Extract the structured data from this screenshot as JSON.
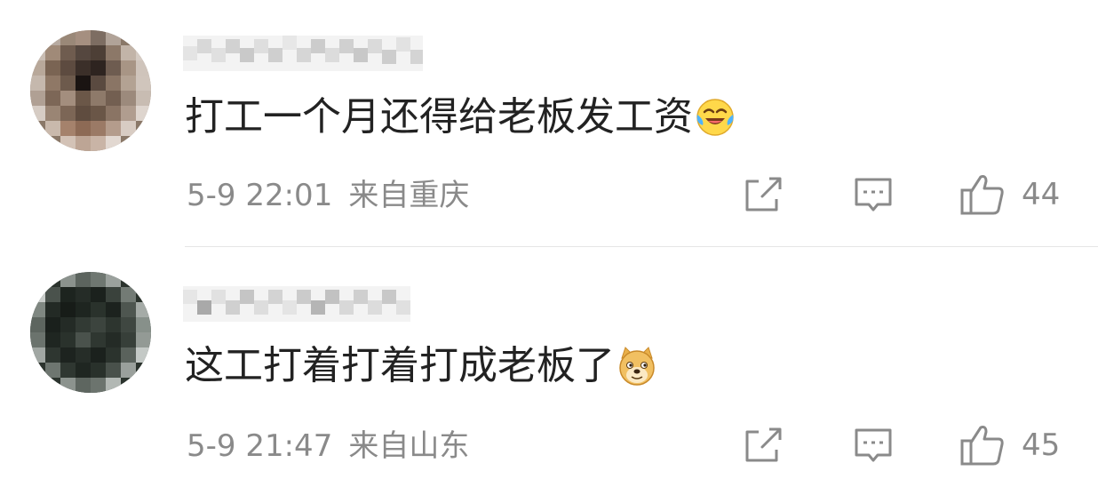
{
  "comments": [
    {
      "text": "打工一个月还得给老板发工资",
      "emoji": "laugh-cry-emoji",
      "time": "5-9 22:01",
      "location": "来自重庆",
      "likes": "44"
    },
    {
      "text": "这工打着打着打成老板了",
      "emoji": "doge-emoji",
      "time": "5-9 21:47",
      "location": "来自山东",
      "likes": "45"
    }
  ],
  "colors": {
    "text": "#222222",
    "meta": "#8a8a8a",
    "icon": "#8a8a8a",
    "divider": "#e6e6e6"
  }
}
